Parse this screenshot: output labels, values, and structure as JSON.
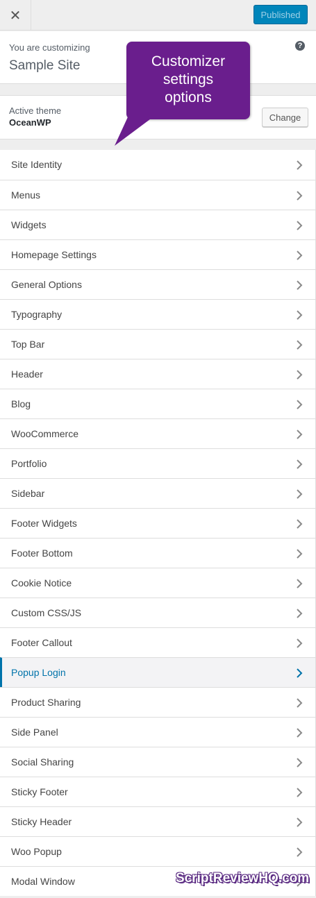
{
  "topbar": {
    "close_symbol": "✕",
    "publish_label": "Published"
  },
  "info": {
    "label": "You are customizing",
    "site_title": "Sample Site",
    "help_symbol": "?"
  },
  "theme": {
    "label": "Active theme",
    "name": "OceanWP",
    "change_label": "Change"
  },
  "menu": {
    "items": [
      {
        "label": "Site Identity"
      },
      {
        "label": "Menus"
      },
      {
        "label": "Widgets"
      },
      {
        "label": "Homepage Settings"
      },
      {
        "label": "General Options"
      },
      {
        "label": "Typography"
      },
      {
        "label": "Top Bar"
      },
      {
        "label": "Header"
      },
      {
        "label": "Blog"
      },
      {
        "label": "WooCommerce"
      },
      {
        "label": "Portfolio"
      },
      {
        "label": "Sidebar"
      },
      {
        "label": "Footer Widgets"
      },
      {
        "label": "Footer Bottom"
      },
      {
        "label": "Cookie Notice"
      },
      {
        "label": "Custom CSS/JS"
      },
      {
        "label": "Footer Callout"
      },
      {
        "label": "Popup Login",
        "active": true
      },
      {
        "label": "Product Sharing"
      },
      {
        "label": "Side Panel"
      },
      {
        "label": "Social Sharing"
      },
      {
        "label": "Sticky Footer"
      },
      {
        "label": "Sticky Header"
      },
      {
        "label": "Woo Popup"
      },
      {
        "label": "Modal Window"
      }
    ]
  },
  "annotation": {
    "callout_text": "Customizer\nsettings\noptions",
    "watermark": "ScriptReviewHQ.com"
  },
  "colors": {
    "accent": "#0073aa",
    "publish_button": "#0085ba",
    "callout": "#6a1e8d"
  },
  "icons": {
    "close": "close-icon",
    "help": "help-icon",
    "chevron": "chevron-right-icon"
  }
}
